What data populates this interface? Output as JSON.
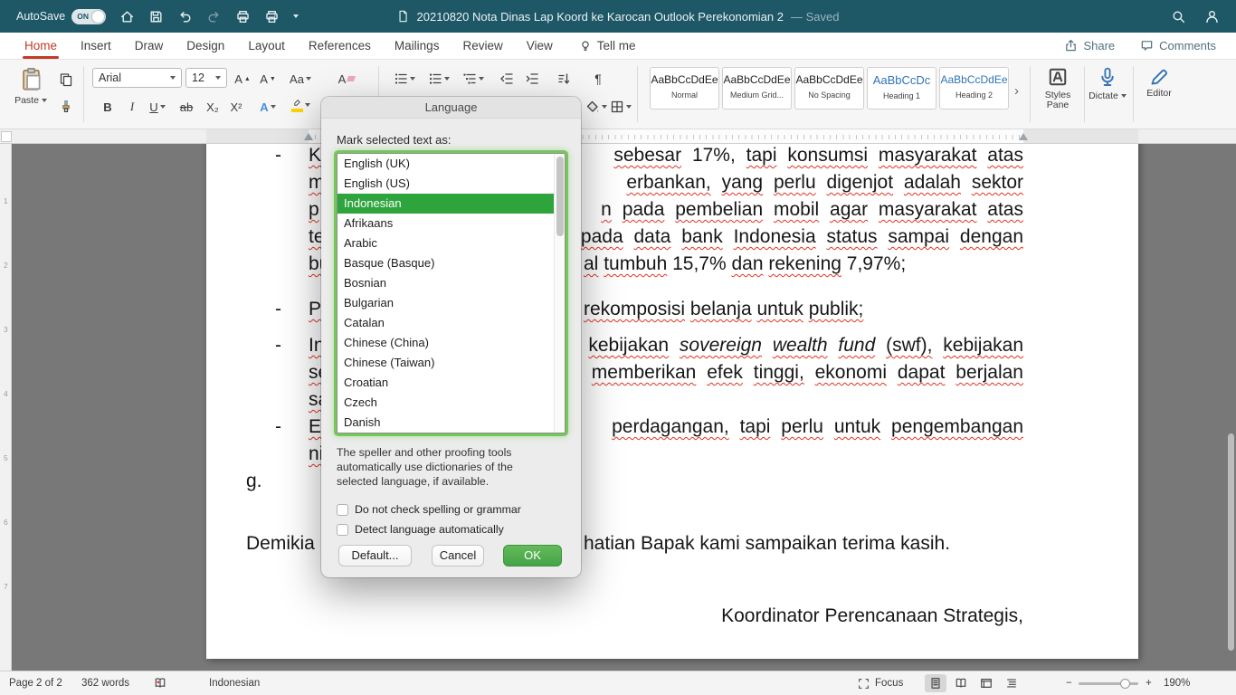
{
  "titlebar": {
    "autosave_label": "AutoSave",
    "autosave_state": "ON",
    "title": "20210820 Nota Dinas Lap Koord ke Karocan Outlook Perekonomian 2",
    "save_status": "— Saved"
  },
  "tabs": {
    "items": [
      "Home",
      "Insert",
      "Draw",
      "Design",
      "Layout",
      "References",
      "Mailings",
      "Review",
      "View"
    ],
    "active": "Home",
    "tell_me": "Tell me",
    "share": "Share",
    "comments": "Comments"
  },
  "ribbon": {
    "paste": "Paste",
    "font_name": "Arial",
    "font_size": "12",
    "bold": "B",
    "italic": "I",
    "underline": "U",
    "strikethrough": "ab",
    "subscript": "X₂",
    "superscript": "X²",
    "grow_font": "A",
    "shrink_font": "A",
    "change_case": "Aa",
    "clear_format": "A",
    "text_effects": "A",
    "font_color": "A",
    "styles": [
      {
        "preview": "AaBbCcDdEe",
        "label": "Normal"
      },
      {
        "preview": "AaBbCcDdEe",
        "label": "Medium Grid..."
      },
      {
        "preview": "AaBbCcDdEe",
        "label": "No Spacing"
      },
      {
        "preview": "AaBbCcDc",
        "label": "Heading 1"
      },
      {
        "preview": "AaBbCcDdEe",
        "label": "Heading 2"
      }
    ],
    "styles_pane": "Styles Pane",
    "dictate": "Dictate",
    "editor": "Editor"
  },
  "dialog": {
    "title": "Language",
    "prompt": "Mark selected text as:",
    "languages": [
      "English (UK)",
      "English (US)",
      "Indonesian",
      "Afrikaans",
      "Arabic",
      "Basque (Basque)",
      "Bosnian",
      "Bulgarian",
      "Catalan",
      "Chinese (China)",
      "Chinese (Taiwan)",
      "Croatian",
      "Czech",
      "Danish"
    ],
    "selected_language": "Indonesian",
    "description": "The speller and other proofing tools automatically use dictionaries of the selected language, if available.",
    "checkbox_no_check": "Do not check spelling or grammar",
    "checkbox_detect": "Detect language automatically",
    "default_button": "Default...",
    "cancel_button": "Cancel",
    "ok_button": "OK"
  },
  "document": {
    "lines": [
      {
        "bullet": "-",
        "left": "K",
        "right": "sebesar 17%, tapi konsumsi masyarakat atas"
      },
      {
        "left": "m",
        "right": "erbankan, yang perlu digenjot adalah sektor"
      },
      {
        "left": "p",
        "right": "n pada pembelian mobil agar masyarakat atas"
      },
      {
        "left": "te",
        "right": "pada data bank Indonesia status sampai dengan"
      },
      {
        "left": "bu",
        "right": "al tumbuh 15,7% dan rekening 7,97%;"
      },
      {
        "bullet": "-",
        "left": "P",
        "right": "rekomposisi belanja untuk publik;"
      },
      {
        "bullet": "-",
        "left": "In",
        "right_pre": "kebijakan ",
        "right_italic": "sovereign wealth fund",
        "right_post": " (swf), kebijakan"
      },
      {
        "left": "se",
        "right": "memberikan efek tinggi, ekonomi dapat berjalan"
      },
      {
        "left": "sa"
      },
      {
        "bullet": "-",
        "left": "E",
        "right": "perdagangan, tapi perlu untuk pengembangan"
      },
      {
        "left": "ni"
      },
      {
        "left": "g."
      },
      {
        "left": "Demikia",
        "right": "hatian Bapak kami sampaikan terima kasih."
      },
      {
        "right": "Koordinator Perencanaan Strategis,"
      }
    ]
  },
  "statusbar": {
    "page": "Page 2 of 2",
    "words": "362 words",
    "language": "Indonesian",
    "focus": "Focus",
    "zoom": "190%"
  },
  "rulers": {
    "vertical": [
      "1",
      "2",
      "3",
      "4",
      "5",
      "6",
      "7"
    ]
  },
  "icons": {
    "pilcrow": "¶",
    "up": "▲",
    "down": "▼",
    "more": "›",
    "minus": "−",
    "plus": "+"
  },
  "colors": {
    "titlebar_teal": "#1e5766",
    "accent_red": "#c03b28",
    "selection_green": "#2ea43d",
    "ok_green": "#4aad4a",
    "heading_blue": "#2E74B5",
    "squiggle_red": "#e03325"
  }
}
